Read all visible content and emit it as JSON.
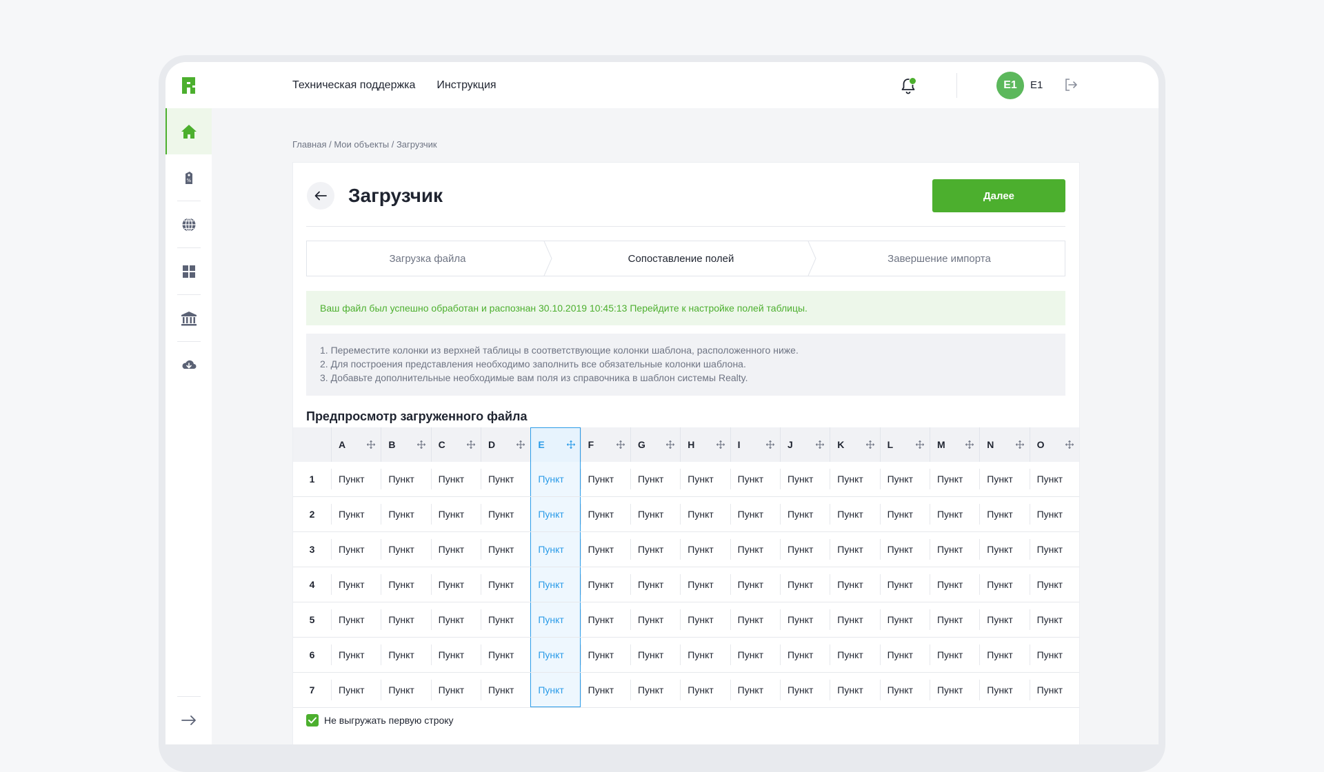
{
  "topbar": {
    "nav": [
      "Техническая поддержка",
      "Инструкция"
    ],
    "user": {
      "initials": "E1",
      "name": "E1"
    }
  },
  "sidebar": {
    "items": [
      {
        "icon": "home-icon",
        "active": true
      },
      {
        "icon": "price-tag-icon",
        "active": false
      },
      {
        "icon": "globe-icon",
        "active": false
      },
      {
        "icon": "dashboard-grid-icon",
        "active": false
      },
      {
        "icon": "bank-icon",
        "active": false
      },
      {
        "icon": "cloud-download-icon",
        "active": false
      }
    ],
    "collapse_icon": "arrow-right-icon"
  },
  "breadcrumb": "Главная / Мои объекты / Загрузчик",
  "page": {
    "title": "Загрузчик",
    "next_button": "Далее"
  },
  "steps": [
    {
      "label": "Загрузка файла",
      "active": false
    },
    {
      "label": "Сопоставление полей",
      "active": true
    },
    {
      "label": "Завершение импорта",
      "active": false
    }
  ],
  "success_message": "Ваш файл был успешно обработан и распознан 30.10.2019 10:45:13 Перейдите к настройке полей таблицы.",
  "instructions": [
    "1. Переместите колонки из верхней таблицы в соответствующие колонки шаблона, расположенного ниже.",
    "2. Для построения представления необходимо заполнить все обязательные колонки шаблона.",
    "3. Добавьте дополнительные необходимые вам поля из справочника в шаблон системы Realty."
  ],
  "preview": {
    "title": "Предпросмотр загруженного файла",
    "columns": [
      "A",
      "B",
      "C",
      "D",
      "E",
      "F",
      "G",
      "H",
      "I",
      "J",
      "K",
      "L",
      "M",
      "N",
      "O"
    ],
    "selected_column": "E",
    "rows": [
      {
        "num": "1",
        "cells": [
          "Пункт",
          "Пункт",
          "Пункт",
          "Пункт",
          "Пункт",
          "Пункт",
          "Пункт",
          "Пункт",
          "Пункт",
          "Пункт",
          "Пункт",
          "Пункт",
          "Пункт",
          "Пункт",
          "Пункт"
        ]
      },
      {
        "num": "2",
        "cells": [
          "Пункт",
          "Пункт",
          "Пункт",
          "Пункт",
          "Пункт",
          "Пункт",
          "Пункт",
          "Пункт",
          "Пункт",
          "Пункт",
          "Пункт",
          "Пункт",
          "Пункт",
          "Пункт",
          "Пункт"
        ]
      },
      {
        "num": "3",
        "cells": [
          "Пункт",
          "Пункт",
          "Пункт",
          "Пункт",
          "Пункт",
          "Пункт",
          "Пункт",
          "Пункт",
          "Пункт",
          "Пункт",
          "Пункт",
          "Пункт",
          "Пункт",
          "Пункт",
          "Пункт"
        ]
      },
      {
        "num": "4",
        "cells": [
          "Пункт",
          "Пункт",
          "Пункт",
          "Пункт",
          "Пункт",
          "Пункт",
          "Пункт",
          "Пункт",
          "Пункт",
          "Пункт",
          "Пункт",
          "Пункт",
          "Пункт",
          "Пункт",
          "Пункт"
        ]
      },
      {
        "num": "5",
        "cells": [
          "Пункт",
          "Пункт",
          "Пункт",
          "Пункт",
          "Пункт",
          "Пункт",
          "Пункт",
          "Пункт",
          "Пункт",
          "Пункт",
          "Пункт",
          "Пункт",
          "Пункт",
          "Пункт",
          "Пункт"
        ]
      },
      {
        "num": "6",
        "cells": [
          "Пункт",
          "Пункт",
          "Пункт",
          "Пункт",
          "Пункт",
          "Пункт",
          "Пункт",
          "Пункт",
          "Пункт",
          "Пункт",
          "Пункт",
          "Пункт",
          "Пункт",
          "Пункт",
          "Пункт"
        ]
      },
      {
        "num": "7",
        "cells": [
          "Пункт",
          "Пункт",
          "Пункт",
          "Пункт",
          "Пункт",
          "Пункт",
          "Пункт",
          "Пункт",
          "Пункт",
          "Пункт",
          "Пункт",
          "Пункт",
          "Пункт",
          "Пункт",
          "Пункт"
        ]
      }
    ]
  },
  "checkbox": {
    "label": "Не выгружать первую строку",
    "checked": true
  },
  "colors": {
    "accent": "#4caf2e",
    "selection": "#2a9be8"
  }
}
